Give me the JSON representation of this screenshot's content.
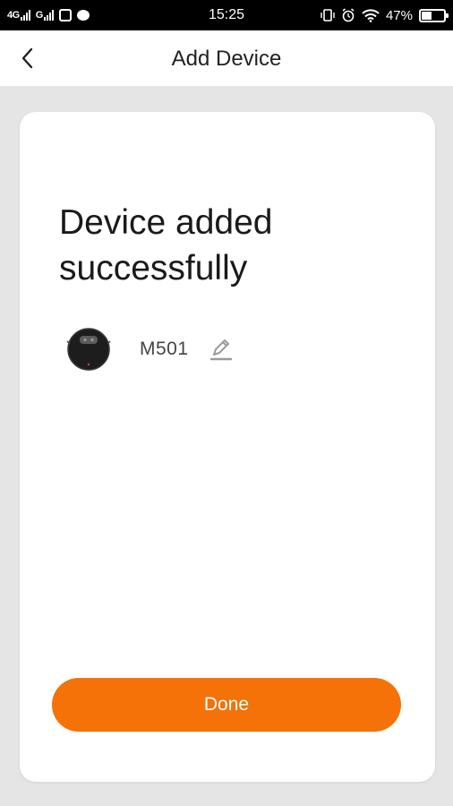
{
  "status_bar": {
    "network_1": "4G",
    "network_2": "G",
    "time": "15:25",
    "battery": "47%",
    "battery_level": 0.47,
    "icons": [
      "signal-icon",
      "signal-icon",
      "gallery-icon",
      "message-bubble-icon",
      "vibrate-icon",
      "alarm-icon",
      "wifi-icon",
      "battery-icon"
    ]
  },
  "app_bar": {
    "title": "Add Device",
    "back_icon": "chevron-left-icon"
  },
  "card": {
    "heading": "Device added successfully",
    "device": {
      "name": "M501",
      "icon": "robot-vacuum-icon",
      "edit_icon": "pencil-icon"
    },
    "done_label": "Done"
  },
  "colors": {
    "accent": "#f47208",
    "background": "#e5e5e5",
    "card": "#ffffff",
    "status_bar": "#000000"
  }
}
